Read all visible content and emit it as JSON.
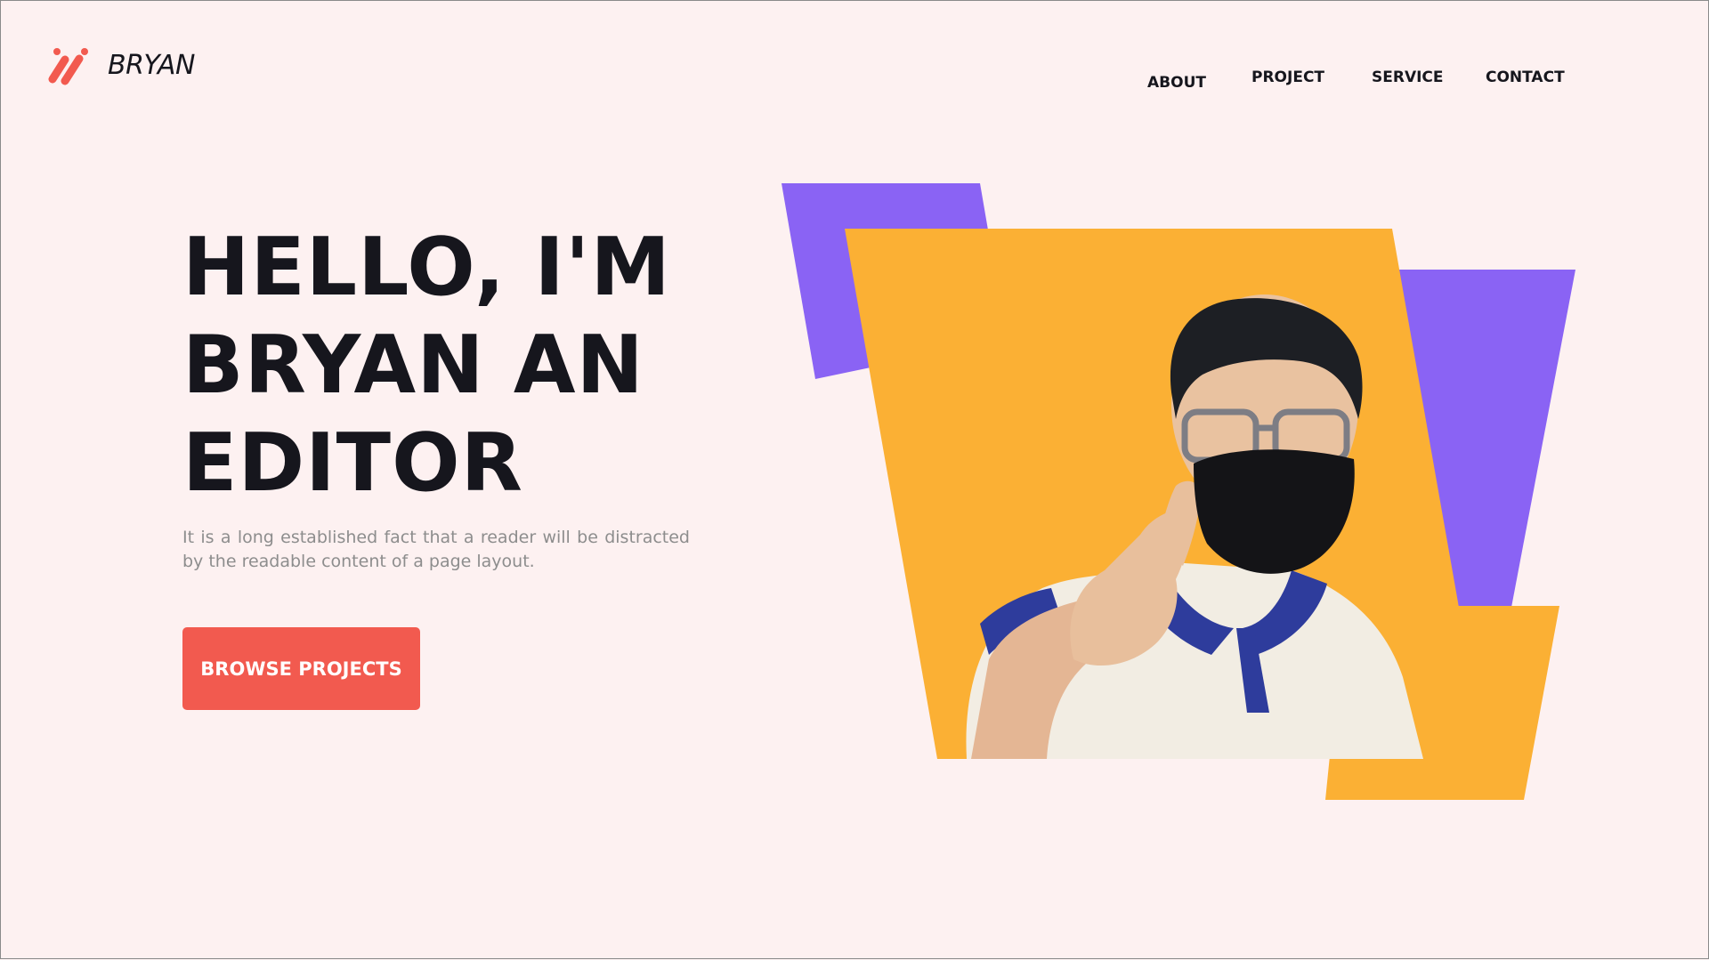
{
  "brand": {
    "name": "BRYAN"
  },
  "nav": {
    "items": [
      {
        "label": "ABOUT"
      },
      {
        "label": "PROJECT"
      },
      {
        "label": "SERVICE"
      },
      {
        "label": "CONTACT"
      }
    ]
  },
  "hero": {
    "title_lines": [
      "HELLO, I'M",
      "BRYAN AN",
      "EDITOR"
    ],
    "description": "It is a long established fact that a reader will be distracted by the readable content of a page layout.",
    "cta_label": "BROWSE PROJECTS",
    "photo_icon": "portrait-photo"
  },
  "colors": {
    "background": "#fdf1f1",
    "accent_red": "#f25a4f",
    "purple": "#8a63f4",
    "orange": "#fbb034",
    "text_dark": "#16161d",
    "text_muted": "#8d8d8d"
  }
}
